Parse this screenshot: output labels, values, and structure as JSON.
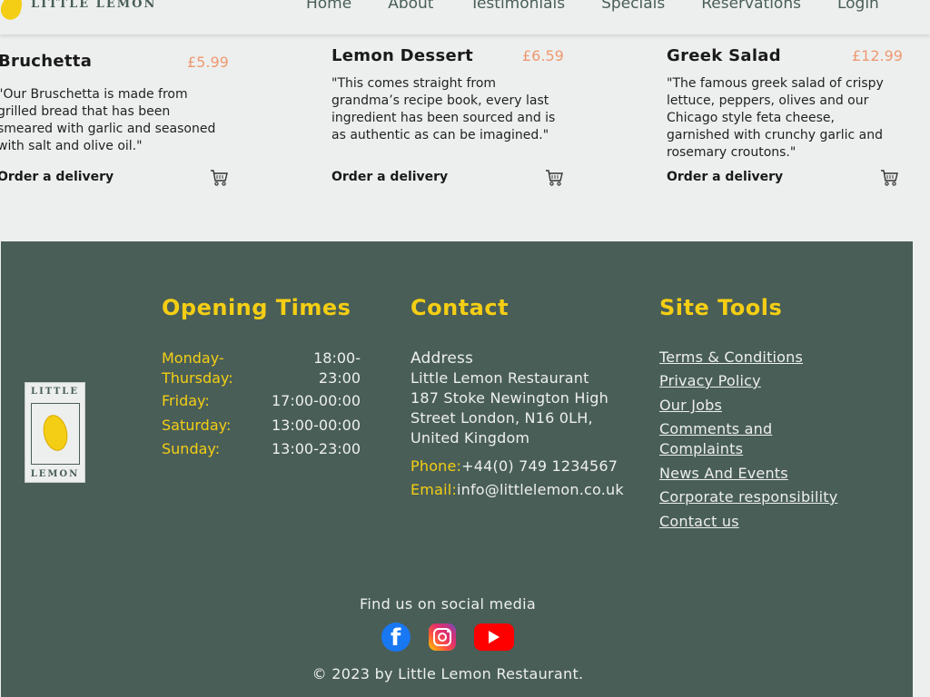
{
  "header": {
    "logo_text": "LITTLE LEMON",
    "nav": [
      "Home",
      "About",
      "Testimonials",
      "Specials",
      "Reservations",
      "Login"
    ]
  },
  "cards": [
    {
      "title": "Bruchetta",
      "price": "£5.99",
      "description": "\"Our Bruschetta is made from grilled bread that has been smeared with garlic and seasoned with salt and olive oil.\"",
      "order": "Order a delivery"
    },
    {
      "title": "Lemon Dessert",
      "price": "£6.59",
      "description": "\"This comes straight from grandma’s recipe book, every last ingredient has been sourced and is as authentic as can be imagined.\"",
      "order": "Order a delivery"
    },
    {
      "title": "Greek Salad",
      "price": "£12.99",
      "description": "\"The famous greek salad of crispy lettuce, peppers, olives and our Chicago style feta cheese, garnished with crunchy garlic and rosemary croutons.\"",
      "order": "Order a delivery"
    }
  ],
  "footer": {
    "logo_top": "LITTLE",
    "logo_bottom": "LEMON",
    "opening": {
      "title": "Opening Times",
      "rows": [
        {
          "day": "Monday- Thursday:",
          "time": "18:00- 23:00"
        },
        {
          "day": "Friday:",
          "time": "17:00-00:00"
        },
        {
          "day": "Saturday:",
          "time": "13:00-00:00"
        },
        {
          "day": "Sunday:",
          "time": "13:00-23:00"
        }
      ]
    },
    "contact": {
      "title": "Contact",
      "address_label": "Address",
      "address_lines": [
        "Little Lemon Restaurant",
        "187 Stoke Newington High",
        "Street London, N16 0LH,",
        "United Kingdom"
      ],
      "phone_label": "Phone:",
      "phone": "+44(0) 749 1234567",
      "email_label": "Email:",
      "email": "info@littlelemon.co.uk"
    },
    "site_tools": {
      "title": "Site Tools",
      "links": [
        "Terms & Conditions",
        "Privacy Policy",
        "Our Jobs",
        "Comments and Complaints",
        "News And Events",
        "Corporate responsibility",
        "Contact us"
      ]
    },
    "social_title": "Find us on social media",
    "copyright": "© 2023 by Little Lemon Restaurant."
  },
  "colors": {
    "primary_green": "#495e57",
    "primary_yellow": "#f4ce14",
    "price_salmon": "#ee9972",
    "background": "#edefee"
  },
  "icons": [
    "lemon-logo-icon",
    "cart-icon",
    "facebook-icon",
    "instagram-icon",
    "youtube-icon"
  ]
}
